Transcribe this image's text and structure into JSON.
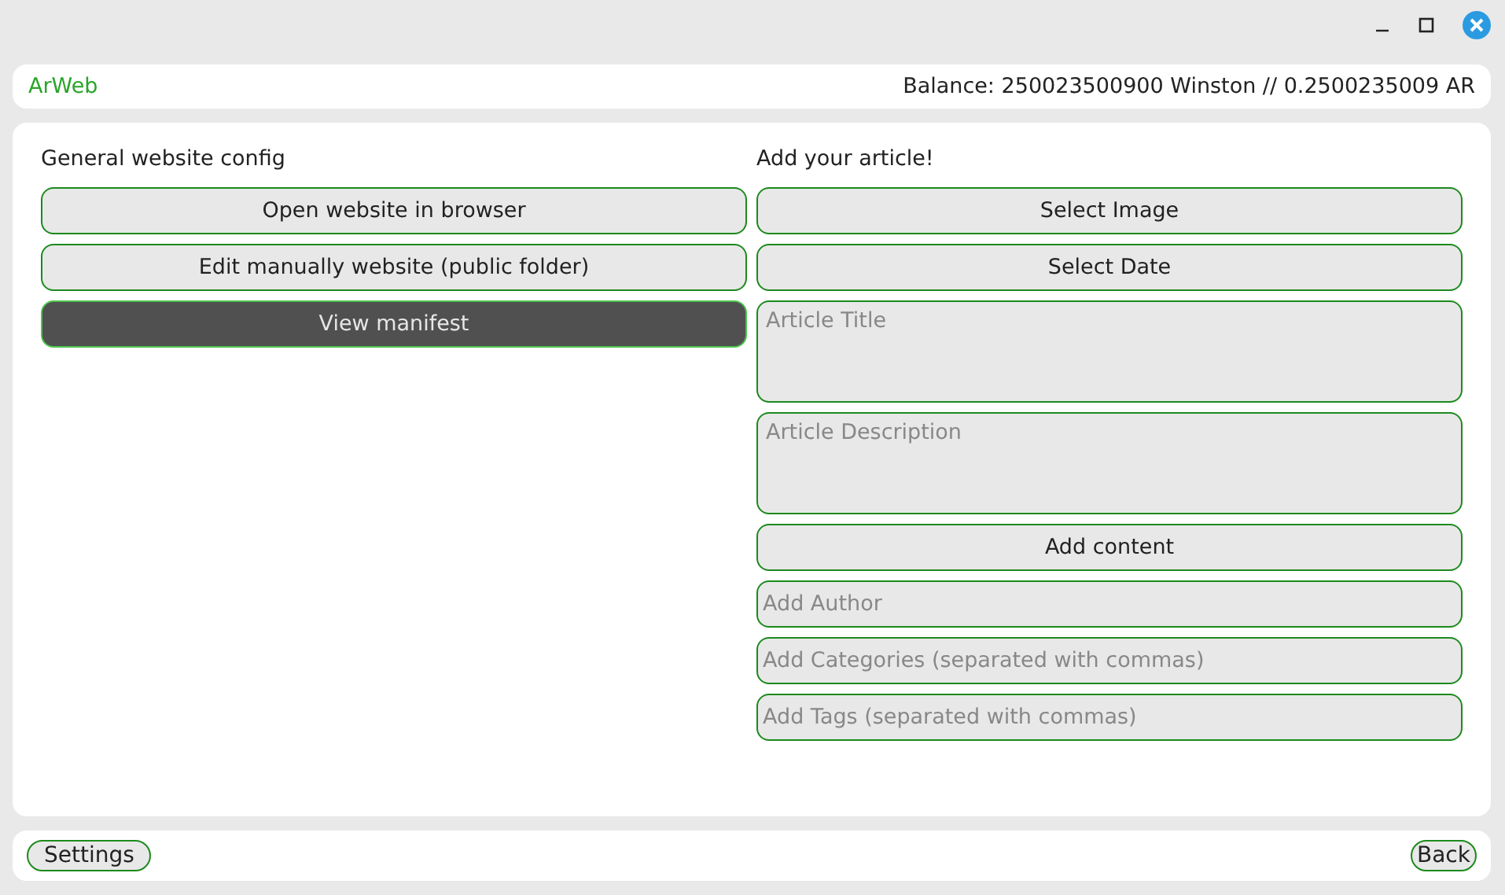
{
  "header": {
    "app_name": "ArWeb",
    "balance": "Balance: 250023500900 Winston // 0.2500235009 AR"
  },
  "left": {
    "heading": "General website config",
    "buttons": [
      {
        "label": "Open website in browser",
        "highlighted": false
      },
      {
        "label": "Edit manually website (public folder)",
        "highlighted": false
      },
      {
        "label": "View manifest",
        "highlighted": true
      }
    ]
  },
  "right": {
    "heading": "Add your article!",
    "items": [
      {
        "kind": "button",
        "label": "Select Image"
      },
      {
        "kind": "button",
        "label": "Select Date"
      },
      {
        "kind": "textarea",
        "placeholder": "Article Title"
      },
      {
        "kind": "textarea",
        "placeholder": "Article Description"
      },
      {
        "kind": "button",
        "label": "Add content"
      },
      {
        "kind": "input",
        "placeholder": "Add Author"
      },
      {
        "kind": "input",
        "placeholder": "Add Categories (separated with commas)"
      },
      {
        "kind": "input",
        "placeholder": "Add Tags (separated with commas)"
      }
    ]
  },
  "footer": {
    "left_button": "Settings",
    "right_button": "Back"
  }
}
